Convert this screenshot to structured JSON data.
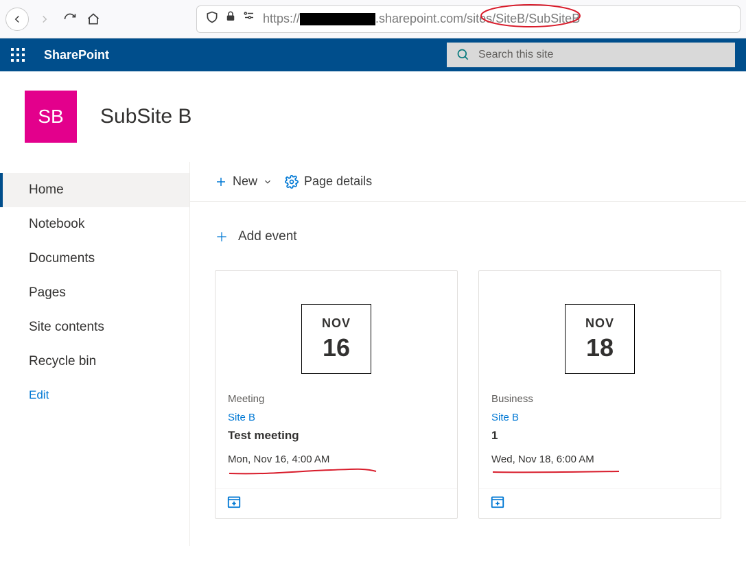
{
  "browser": {
    "url_prefix": "https://",
    "url_domain_suffix": ".sharepoint.com",
    "url_path": "/sites/SiteB/SubSiteB"
  },
  "suite": {
    "title": "SharePoint",
    "search_placeholder": "Search this site"
  },
  "site": {
    "logo_initials": "SB",
    "title": "SubSite B"
  },
  "leftnav": {
    "items": [
      {
        "label": "Home",
        "selected": true
      },
      {
        "label": "Notebook"
      },
      {
        "label": "Documents"
      },
      {
        "label": "Pages"
      },
      {
        "label": "Site contents"
      },
      {
        "label": "Recycle bin"
      }
    ],
    "edit_label": "Edit"
  },
  "cmdbar": {
    "new_label": "New",
    "details_label": "Page details"
  },
  "events": {
    "add_label": "Add event",
    "cards": [
      {
        "month": "NOV",
        "day": "16",
        "category": "Meeting",
        "site": "Site B",
        "title": "Test meeting",
        "time": "Mon, Nov 16, 4:00 AM"
      },
      {
        "month": "NOV",
        "day": "18",
        "category": "Business",
        "site": "Site B",
        "title": "1",
        "time": "Wed, Nov 18, 6:00 AM"
      }
    ]
  }
}
